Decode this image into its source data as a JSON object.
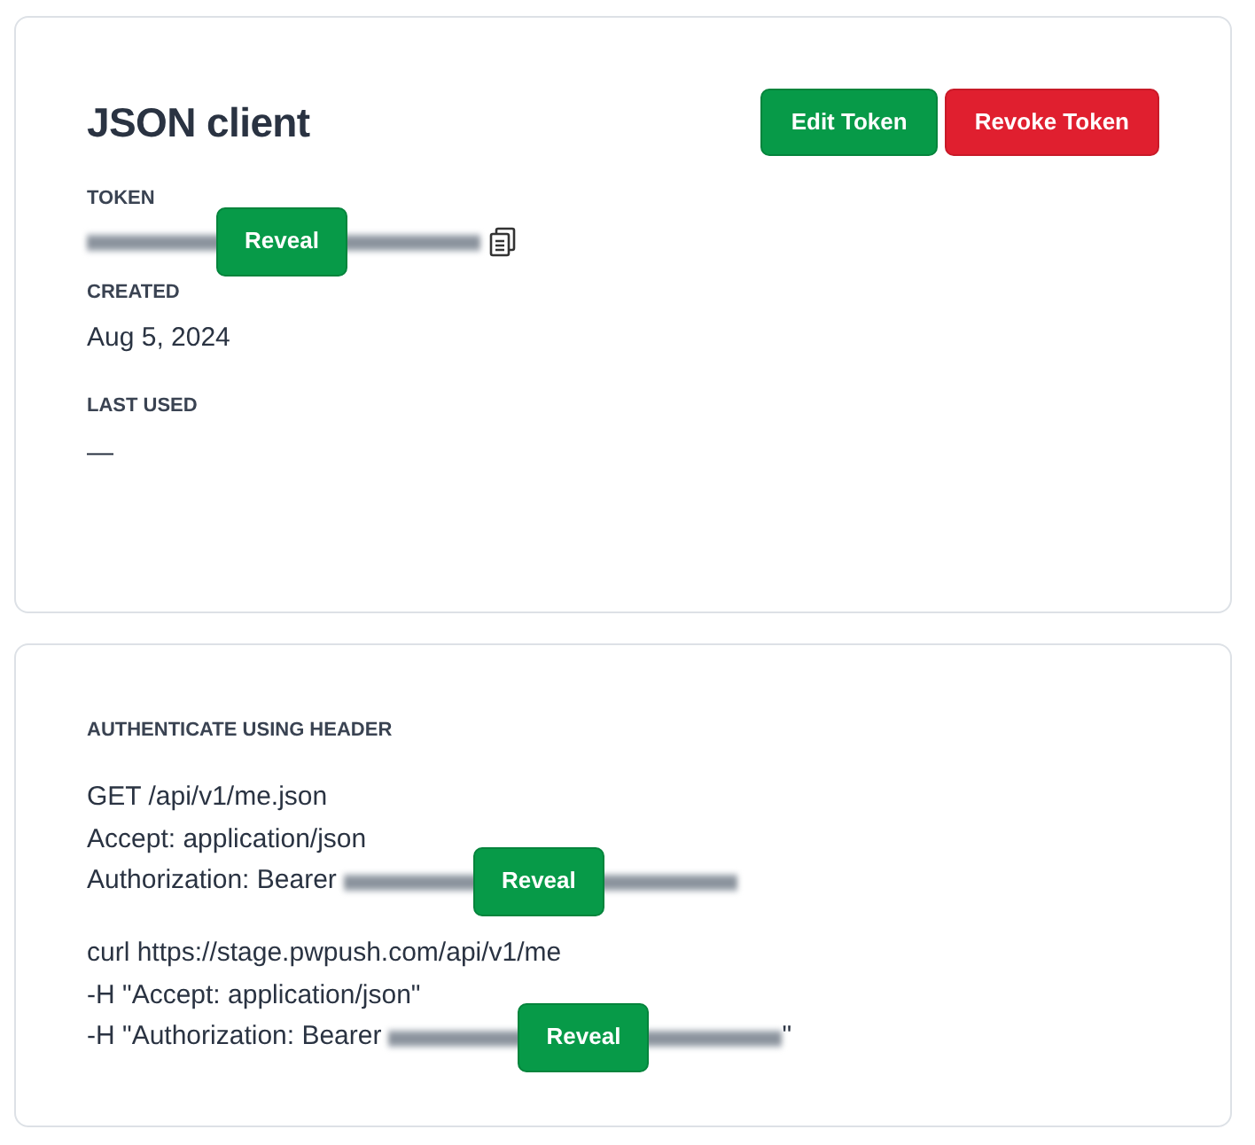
{
  "token_card": {
    "title": "JSON client",
    "buttons": [
      {
        "label": "Edit Token",
        "kind": "edit"
      },
      {
        "label": "Revoke Token",
        "kind": "revoke"
      }
    ],
    "fields": [
      {
        "label": "TOKEN",
        "kind": "secret",
        "reveal": "Reveal"
      },
      {
        "label": "CREATED",
        "kind": "text",
        "value": "Aug 5, 2024"
      },
      {
        "label": "LAST USED",
        "kind": "text",
        "value": "—"
      }
    ]
  },
  "header_card": {
    "label": "AUTHENTICATE USING HEADER",
    "blocks": [
      [
        {
          "kind": "text",
          "text": "GET /api/v1/me.json"
        },
        {
          "kind": "text",
          "text": "Accept: application/json"
        },
        {
          "kind": "secret",
          "text": "Authorization: Bearer",
          "reveal": "Reveal"
        }
      ],
      [
        {
          "kind": "text",
          "text": "curl https://stage.pwpush.com/api/v1/me"
        },
        {
          "kind": "text",
          "text": "-H \"Accept: application/json\""
        },
        {
          "kind": "secret",
          "text": "-H \"Authorization: Bearer",
          "reveal": "Reveal",
          "suffix": "\""
        }
      ]
    ]
  }
}
